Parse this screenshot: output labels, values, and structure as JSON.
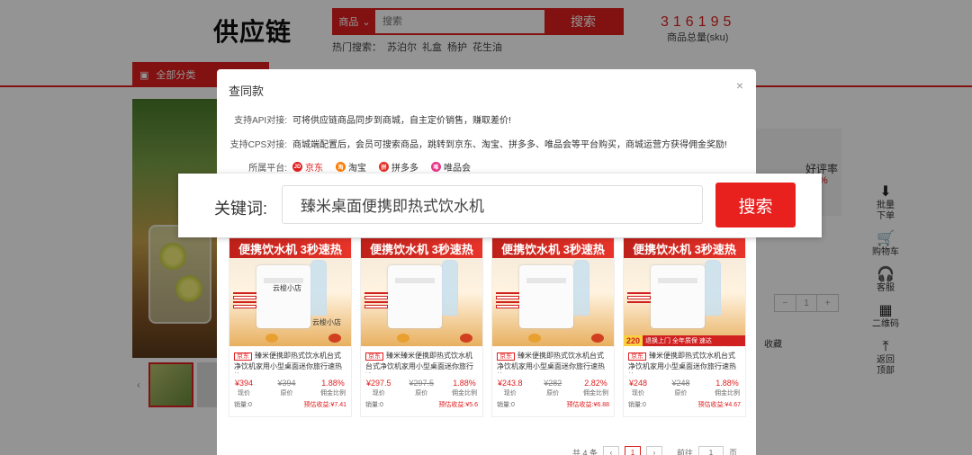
{
  "header": {
    "logo": "供应链",
    "search_type": "商品",
    "search_placeholder": "搜索",
    "search_button": "搜索",
    "hot_label": "热门搜索：",
    "hot_terms": [
      "苏泊尔",
      "礼盒",
      "杨护",
      "花生油"
    ],
    "sku_count": "316195",
    "sku_label": "商品总量(sku)",
    "category_button": "全部分类"
  },
  "product_page": {
    "good_rate_label": "好评率",
    "good_rate_value": "%",
    "quantity": "1",
    "collect_label": "收藏"
  },
  "side_tools": [
    {
      "icon": "batch-order-icon",
      "glyph": "⬇",
      "label": "批量下单"
    },
    {
      "icon": "cart-icon",
      "glyph": "🛒",
      "label": "购物车"
    },
    {
      "icon": "service-icon",
      "glyph": "🎧",
      "label": "客服"
    },
    {
      "icon": "qrcode-icon",
      "glyph": "▦",
      "label": "二维码"
    },
    {
      "icon": "back-to-top-icon",
      "glyph": "⤒",
      "label": "返回顶部"
    }
  ],
  "modal": {
    "title": "查同款",
    "close": "×",
    "api_label": "支持API对接:",
    "api_text": "可将供应链商品同步到商城，自主定价销售，赚取差价!",
    "cps_label": "支持CPS对接:",
    "cps_text": "商城端配置后，会员可搜索商品，跳转到京东、淘宝、拼多多、唯品会等平台购买，商城运营方获得佣金奖励!",
    "platform_label": "所属平台:",
    "platforms": [
      {
        "name": "京东",
        "badge": "JD",
        "color": "#e02020",
        "active": true
      },
      {
        "name": "淘宝",
        "badge": "淘",
        "color": "#ff7a00",
        "active": false
      },
      {
        "name": "拼多多",
        "badge": "拼",
        "color": "#e02e24",
        "active": false
      },
      {
        "name": "唯品会",
        "badge": "唯",
        "color": "#e8348a",
        "active": false
      }
    ],
    "keyword_label": "关键词:",
    "keyword_value": "臻米桌面便携即热式饮水机",
    "search_button": "搜索",
    "cards": [
      {
        "banner": "便携饮水机 3秒速热",
        "platform_tag": "京东",
        "title": "臻米便携即热式饮水机台式净饮机家用小型桌面迷你旅行速热烧...",
        "price": "¥394",
        "price_label": "现价",
        "orig_price": "¥394",
        "orig_label": "原价",
        "rate": "1.88%",
        "rate_label": "佣金比例",
        "sold": "销量:0",
        "earn": "预估收益:¥7.41",
        "watermark": "云梭小店",
        "promo": ""
      },
      {
        "banner": "便携饮水机 3秒速热",
        "platform_tag": "京东",
        "title": "臻米臻米便携即热式饮水机台式净饮机家用小型桌面迷你旅行速...",
        "price": "¥297.5",
        "price_label": "现价",
        "orig_price": "¥297.5",
        "orig_label": "原价",
        "rate": "1.88%",
        "rate_label": "佣金比例",
        "sold": "销量:0",
        "earn": "预估收益:¥5.6",
        "watermark": "",
        "promo": ""
      },
      {
        "banner": "便携饮水机 3秒速热",
        "platform_tag": "京东",
        "title": "臻米便携即热式饮水机台式净饮机家用小型桌面迷你旅行速热烧...",
        "price": "¥243.8",
        "price_label": "现价",
        "orig_price": "¥282",
        "orig_label": "原价",
        "rate": "2.82%",
        "rate_label": "佣金比例",
        "sold": "销量:0",
        "earn": "预估收益:¥6.88",
        "watermark": "",
        "promo": ""
      },
      {
        "banner": "便携饮水机 3秒速热",
        "platform_tag": "京东",
        "title": "臻米便携即热式饮水机台式净饮机家用小型桌面迷你旅行速热烧...",
        "price": "¥248",
        "price_label": "现价",
        "orig_price": "¥248",
        "orig_label": "原价",
        "rate": "1.88%",
        "rate_label": "佣金比例",
        "sold": "销量:0",
        "earn": "预估收益:¥4.67",
        "watermark": "",
        "promo": "220",
        "promo_text": "退换上门 全年质保 速达"
      }
    ],
    "pager": {
      "total": "共 4 条",
      "prev": "‹",
      "current": "1",
      "next": "›",
      "goto": "前往",
      "goto_value": "1",
      "page_unit": "页"
    }
  }
}
